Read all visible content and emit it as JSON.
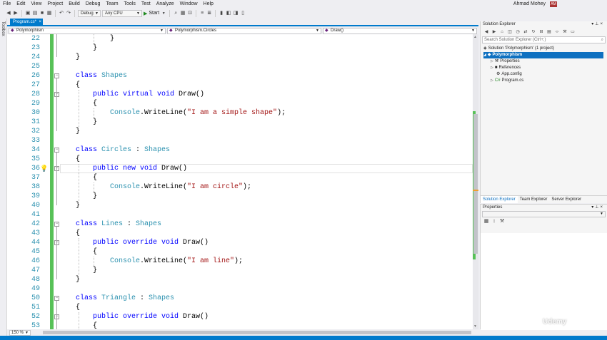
{
  "menu": {
    "items": [
      "File",
      "Edit",
      "View",
      "Project",
      "Build",
      "Debug",
      "Team",
      "Tools",
      "Test",
      "Analyze",
      "Window",
      "Help"
    ],
    "user": "Ahmad Mohey",
    "avatar": "AM"
  },
  "toolbar": {
    "config": "Debug",
    "platform": "Any CPU",
    "start_label": "Start"
  },
  "toolbox_label": "Toolbox",
  "doc_tab": {
    "label": "Program.cs*",
    "close": "×"
  },
  "nav": {
    "project": "Polymorphism",
    "type": "Polymorphism.Circles",
    "member": "Draw()"
  },
  "editor": {
    "lines": [
      {
        "n": "22",
        "code": "        }"
      },
      {
        "n": "23",
        "code": "    }"
      },
      {
        "n": "24",
        "code": "}"
      },
      {
        "n": "25",
        "code": ""
      },
      {
        "n": "26",
        "kw": "class ",
        "ty": "Shapes",
        "rest": ""
      },
      {
        "n": "27",
        "code": "{"
      },
      {
        "n": "28",
        "kw": "    public virtual void ",
        "rest": "Draw()"
      },
      {
        "n": "29",
        "code": "    {"
      },
      {
        "n": "30",
        "ty": "        Console",
        "rest": ".WriteLine(",
        "st": "\"I am a simple shape\"",
        "end": ");"
      },
      {
        "n": "31",
        "code": "    }"
      },
      {
        "n": "32",
        "code": "}"
      },
      {
        "n": "33",
        "code": ""
      },
      {
        "n": "34",
        "kw": "class ",
        "ty": "Circles",
        "rest": " : ",
        "ty2": "Shapes"
      },
      {
        "n": "35",
        "code": "{"
      },
      {
        "n": "36",
        "kw": "    public new void ",
        "rest": "Draw()"
      },
      {
        "n": "37",
        "code": "    {"
      },
      {
        "n": "38",
        "ty": "        Console",
        "rest": ".WriteLine(",
        "st": "\"I am circle\"",
        "end": ");"
      },
      {
        "n": "39",
        "code": "    }"
      },
      {
        "n": "40",
        "code": "}"
      },
      {
        "n": "41",
        "code": ""
      },
      {
        "n": "42",
        "kw": "class ",
        "ty": "Lines",
        "rest": " : ",
        "ty2": "Shapes"
      },
      {
        "n": "43",
        "code": "{"
      },
      {
        "n": "44",
        "kw": "    public override void ",
        "rest": "Draw()"
      },
      {
        "n": "45",
        "code": "    {"
      },
      {
        "n": "46",
        "ty": "        Console",
        "rest": ".WriteLine(",
        "st": "\"I am line\"",
        "end": ");"
      },
      {
        "n": "47",
        "code": "    }"
      },
      {
        "n": "48",
        "code": "}"
      },
      {
        "n": "49",
        "code": ""
      },
      {
        "n": "50",
        "kw": "class ",
        "ty": "Triangle",
        "rest": " : ",
        "ty2": "Shapes"
      },
      {
        "n": "51",
        "code": "{"
      },
      {
        "n": "52",
        "kw": "    public override void ",
        "rest": "Draw()"
      },
      {
        "n": "53",
        "code": "    {"
      }
    ],
    "zoom": "150 %"
  },
  "solution_explorer": {
    "title": "Solution Explorer",
    "search_placeholder": "Search Solution Explorer (Ctrl+;)",
    "tree": [
      {
        "label": "Solution 'Polymorphism' (1 project)",
        "icon": "solution-icon"
      },
      {
        "label": "Polymorphism",
        "icon": "csharp-project-icon"
      },
      {
        "label": "Properties",
        "icon": "wrench-icon"
      },
      {
        "label": "References",
        "icon": "references-icon"
      },
      {
        "label": "App.config",
        "icon": "config-file-icon"
      },
      {
        "label": "Program.cs",
        "icon": "csharp-file-icon"
      }
    ],
    "tabs": [
      "Solution Explorer",
      "Team Explorer",
      "Server Explorer"
    ]
  },
  "properties": {
    "title": "Properties"
  },
  "watermark": "Udemy",
  "colors": {
    "accent": "#007acc",
    "keyword": "#0000ff",
    "type": "#2b91af",
    "string": "#a31515",
    "change_bar": "#57c157"
  }
}
